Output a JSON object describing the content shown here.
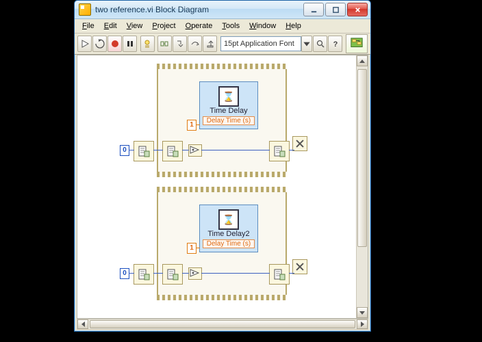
{
  "window": {
    "title": "two reference.vi Block Diagram"
  },
  "menu": {
    "file": "File",
    "edit": "Edit",
    "view": "View",
    "project": "Project",
    "operate": "Operate",
    "tools": "Tools",
    "window": "Window",
    "help": "Help"
  },
  "toolbar": {
    "font_label": "15pt Application Font"
  },
  "diagram": {
    "block1": {
      "subvi_label": "Time Delay",
      "param_label": "Delay Time (s)",
      "delay_const": "1",
      "outer_const": "0"
    },
    "block2": {
      "subvi_label": "Time Delay2",
      "param_label": "Delay Time (s)",
      "delay_const": "1",
      "outer_const": "0"
    }
  }
}
